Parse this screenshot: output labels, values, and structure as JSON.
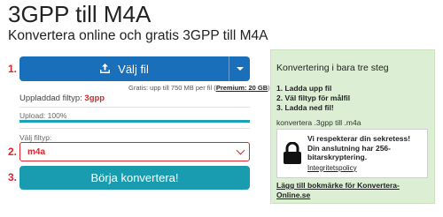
{
  "header": {
    "title": "3GPP till M4A",
    "subtitle": "Konvertera online och gratis 3GPP till M4A"
  },
  "steps": [
    "1.",
    "2.",
    "3."
  ],
  "upload": {
    "choose_label": "Välj fil",
    "limit_text": "Gratis: upp till 750 MB per fil",
    "limit_link": "Premium: 20 GB",
    "filetype_label": "Uppladdad filtyp:",
    "filetype_value": "3gpp",
    "progress_label": "Upload: 100%",
    "progress_fraction": 1.0
  },
  "target": {
    "label": "Välj filtyp:",
    "selected": "m4a"
  },
  "convert_label": "Börja konvertera!",
  "sidebar": {
    "heading": "Konvertering i bara tre steg",
    "steps": [
      "1. Ladda upp fil",
      "2. Väl filtyp för målfil",
      "3. Ladda ned fil!"
    ],
    "conversion": "konvertera .3gpp till .m4a",
    "privacy_text": "Vi respekterar din sekretess! Din anslutning har 256-bitarskryptering.",
    "privacy_link": "Integritetspolicy",
    "bookmark": "Lägg till bokmärke för Konvertera-Online.se"
  },
  "colors": {
    "primary_button": "#1a6fbb",
    "convert_button": "#1a9cb0",
    "accent_red": "#d9262f",
    "sidebar_bg": "#dcefd4"
  }
}
